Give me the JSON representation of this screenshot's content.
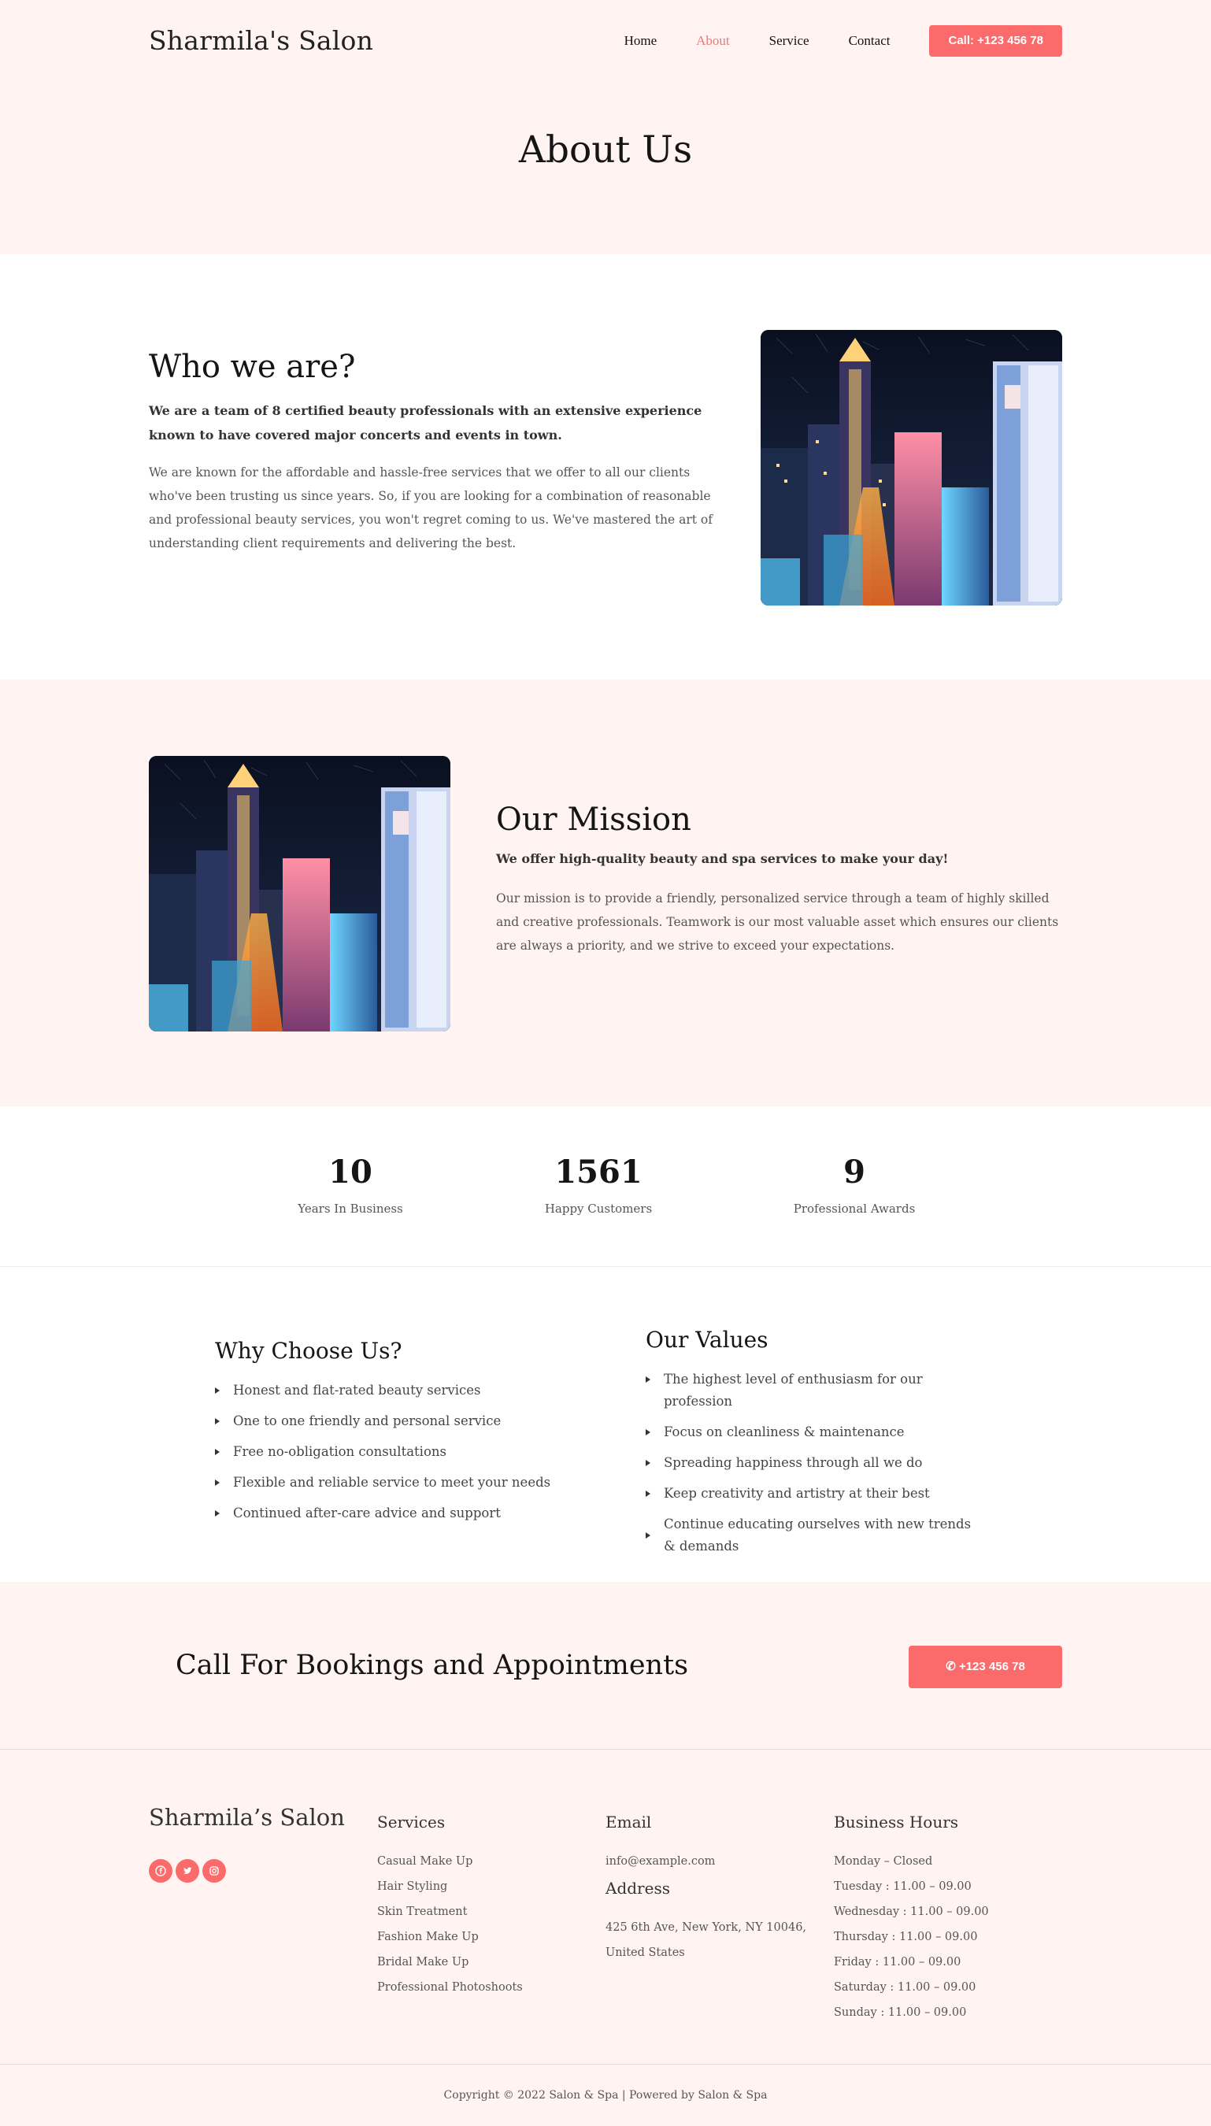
{
  "header": {
    "brand": "Sharmila's Salon",
    "nav": [
      {
        "label": "Home",
        "active": false
      },
      {
        "label": "About",
        "active": true
      },
      {
        "label": "Service",
        "active": false
      },
      {
        "label": "Contact",
        "active": false
      }
    ],
    "call_button": "Call: +123 456 78",
    "page_title": "About Us"
  },
  "who": {
    "title": "Who we are?",
    "lead": "We are a team of 8 certified beauty professionals with an extensive experience known to have covered major concerts and events in town.",
    "body": "We are known for the affordable and hassle-free services that we offer to all our clients who've been trusting us since years. So, if you are looking for a combination of reasonable and professional beauty services, you won't regret coming to us. We've mastered the art of understanding client requirements and delivering the best."
  },
  "mission": {
    "title": "Our Mission",
    "lead": "We offer high-quality beauty and spa services to make your day!",
    "body": "Our mission is to provide a friendly, personalized service through a team of highly skilled and creative professionals. Teamwork is our most valuable asset which ensures our clients are always a priority, and we strive to exceed your expectations."
  },
  "stats": [
    {
      "value": "10",
      "label": "Years In Business"
    },
    {
      "value": "1561",
      "label": "Happy Customers"
    },
    {
      "value": "9",
      "label": "Professional Awards"
    }
  ],
  "why": {
    "title": "Why Choose Us?",
    "items": [
      "Honest and flat-rated beauty services",
      "One to one friendly and personal service",
      "Free no-obligation consultations",
      "Flexible and reliable service to meet your needs",
      "Continued after-care advice and support"
    ]
  },
  "values": {
    "title": "Our Values",
    "items": [
      "The highest level of enthusiasm for our profession",
      "Focus on cleanliness & maintenance",
      "Spreading happiness through all we do",
      "Keep creativity and artistry at their best",
      "Continue educating ourselves with new trends & demands"
    ]
  },
  "cta": {
    "title": "Call For Bookings and Appointments",
    "button": "+123 456 78"
  },
  "footer": {
    "brand": "Sharmila’s Salon",
    "social_icons": [
      "facebook-icon",
      "twitter-icon",
      "instagram-icon"
    ],
    "services": {
      "title": "Services",
      "items": [
        "Casual Make Up",
        "Hair Styling",
        "Skin Treatment",
        "Fashion Make Up",
        "Bridal Make Up",
        "Professional Photoshoots"
      ]
    },
    "email": {
      "title": "Email",
      "value": "info@example.com"
    },
    "address": {
      "title": "Address",
      "value": "425 6th Ave, New York, NY 10046, United States"
    },
    "hours": {
      "title": "Business Hours",
      "items": [
        "Monday – Closed",
        "Tuesday : 11.00 – 09.00",
        "Wednesday : 11.00 – 09.00",
        "Thursday : 11.00 – 09.00",
        "Friday : 11.00 – 09.00",
        "Saturday : 11.00 – 09.00",
        "Sunday : 11.00 – 09.00"
      ]
    },
    "copyright": "Copyright © 2022 Salon & Spa | Powered by Salon & Spa"
  },
  "colors": {
    "accent": "#fb6b6c",
    "nav_active": "#e97a7a",
    "section_bg": "#fff4f2"
  }
}
